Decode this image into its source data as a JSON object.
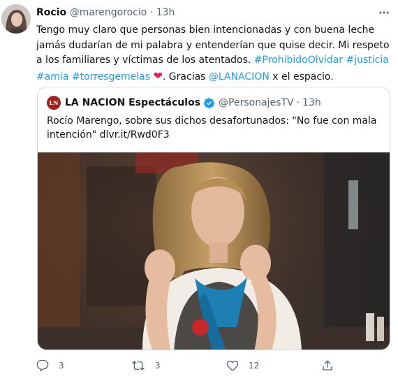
{
  "tweet": {
    "author_name": "Rocio",
    "handle": "@marengorocio",
    "separator": "·",
    "time": "13h",
    "text": {
      "line_a": "Tengo muy claro que personas bien intencionadas y con buena leche jamás dudarían de mi palabra y entenderían que quise decir. Mi respeto a los familiares y víctimas de los atentados. ",
      "tag1": "#ProhibidoOlvidar",
      "tag2": "#justicia",
      "tag3": "#amia",
      "tag4": "#torresgemelas",
      "heart": "❤",
      "mid": ". Gracias ",
      "mention": "@LANACION",
      "end": " x el espacio."
    }
  },
  "quoted": {
    "logo_text": "LN",
    "name": "LA NACION Espectáculos",
    "handle": "@PersonajesTV",
    "separator": "·",
    "time": "13h",
    "text": "Rocío Marengo, sobre sus dichos desafortunados: \"No fue con mala intención\" dlvr.it/Rwd0F3"
  },
  "actions": {
    "reply_count": "3",
    "retweet_count": "3",
    "like_count": "12"
  },
  "icons": {
    "more": "more-icon",
    "verified": "verified-badge-icon",
    "reply": "reply-icon",
    "retweet": "retweet-icon",
    "like": "like-icon",
    "share": "share-icon"
  },
  "colors": {
    "link": "#1d9bf0",
    "muted": "#536471",
    "heart": "#e0245e",
    "verified": "#1d9bf0"
  }
}
